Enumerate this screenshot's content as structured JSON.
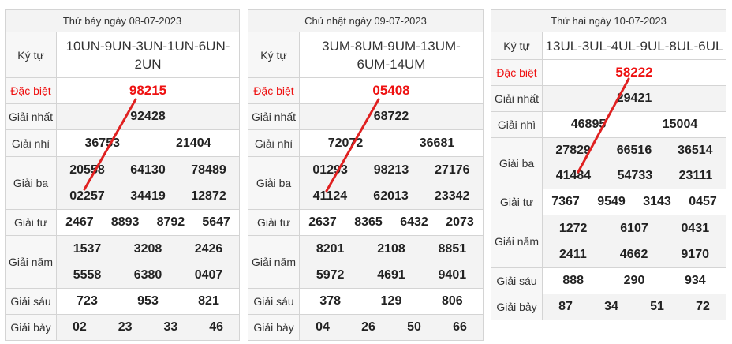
{
  "boards": [
    {
      "date_title": "Thứ bảy ngày 08-07-2023",
      "ky_tu_label": "Ký tự",
      "ky_tu": "10UN-9UN-3UN-1UN-6UN-2UN",
      "dac_biet_label": "Đặc biệt",
      "dac_biet": "98215",
      "nhat_label": "Giải nhất",
      "nhat": "92428",
      "nhi_label": "Giải nhì",
      "nhi": [
        "36753",
        "21404"
      ],
      "ba_label": "Giải ba",
      "ba": [
        "20558",
        "64130",
        "78489",
        "02257",
        "34419",
        "12872"
      ],
      "tu_label": "Giải tư",
      "tu": [
        "2467",
        "8893",
        "8792",
        "5647"
      ],
      "nam_label": "Giải năm",
      "nam": [
        "1537",
        "3208",
        "2426",
        "5558",
        "6380",
        "0407"
      ],
      "sau_label": "Giải sáu",
      "sau": [
        "723",
        "953",
        "821"
      ],
      "bay_label": "Giải bảy",
      "bay": [
        "02",
        "23",
        "33",
        "46"
      ]
    },
    {
      "date_title": "Chủ nhật ngày 09-07-2023",
      "ky_tu_label": "Ký tự",
      "ky_tu": "3UM-8UM-9UM-13UM-6UM-14UM",
      "dac_biet_label": "Đặc biệt",
      "dac_biet": "05408",
      "nhat_label": "Giải nhất",
      "nhat": "68722",
      "nhi_label": "Giải nhì",
      "nhi": [
        "72072",
        "36681"
      ],
      "ba_label": "Giải ba",
      "ba": [
        "01293",
        "98213",
        "27176",
        "41124",
        "62013",
        "23342"
      ],
      "tu_label": "Giải tư",
      "tu": [
        "2637",
        "8365",
        "6432",
        "2073"
      ],
      "nam_label": "Giải năm",
      "nam": [
        "8201",
        "2108",
        "8851",
        "5972",
        "4691",
        "9401"
      ],
      "sau_label": "Giải sáu",
      "sau": [
        "378",
        "129",
        "806"
      ],
      "bay_label": "Giải bảy",
      "bay": [
        "04",
        "26",
        "50",
        "66"
      ]
    },
    {
      "date_title": "Thứ hai ngày 10-07-2023",
      "ky_tu_label": "Ký tự",
      "ky_tu": "13UL-3UL-4UL-9UL-8UL-6UL",
      "dac_biet_label": "Đặc biệt",
      "dac_biet": "58222",
      "nhat_label": "Giải nhất",
      "nhat": "29421",
      "nhi_label": "Giải nhì",
      "nhi": [
        "46895",
        "15004"
      ],
      "ba_label": "Giải ba",
      "ba": [
        "27829",
        "66516",
        "36514",
        "41484",
        "54733",
        "23111"
      ],
      "tu_label": "Giải tư",
      "tu": [
        "7367",
        "9549",
        "3143",
        "0457"
      ],
      "nam_label": "Giải năm",
      "nam": [
        "1272",
        "6107",
        "0431",
        "2411",
        "4662",
        "9170"
      ],
      "sau_label": "Giải sáu",
      "sau": [
        "888",
        "290",
        "934"
      ],
      "bay_label": "Giải bảy",
      "bay": [
        "87",
        "34",
        "51",
        "72"
      ]
    }
  ],
  "colors": {
    "special": "#e11111",
    "annotation_line": "#e02020",
    "header_bg": "#f3f3f3"
  }
}
